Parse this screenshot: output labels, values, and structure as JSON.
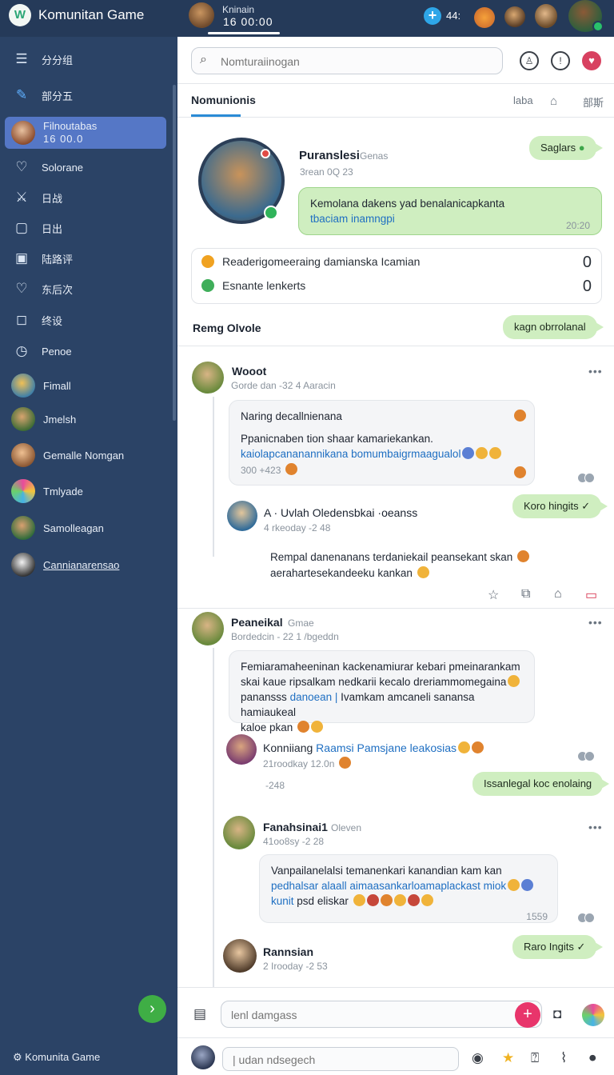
{
  "app": {
    "title": "Komunitan Game"
  },
  "topbar": {
    "user_name": "Kninain",
    "user_time": "16 00:00",
    "count": "44:"
  },
  "sidebar": {
    "items": [
      {
        "label": "分分组",
        "icon": "menu-icon"
      },
      {
        "label": "部分五",
        "icon": "edit-icon"
      },
      {
        "label": "Filnoutabas",
        "sub": "16 00.0",
        "icon": "avatar"
      },
      {
        "label": "Solorane",
        "icon": "heart-icon"
      },
      {
        "label": "日战",
        "icon": "sword-icon"
      },
      {
        "label": "日出",
        "icon": "file-icon"
      },
      {
        "label": "陆路评",
        "icon": "board-icon"
      },
      {
        "label": "东后次",
        "icon": "heart-icon"
      },
      {
        "label": "终设",
        "icon": "chat-icon"
      },
      {
        "label": "Penoe",
        "icon": "clock-icon"
      },
      {
        "label": "Fimall",
        "icon": "avatar"
      },
      {
        "label": "Jmelsh",
        "icon": "avatar"
      },
      {
        "label": "Gemalle Nomgan",
        "icon": "avatar"
      },
      {
        "label": "Tmlyade",
        "icon": "avatar"
      },
      {
        "label": "Samolleagan",
        "icon": "avatar"
      },
      {
        "label": "Cannianarensao",
        "icon": "avatar"
      }
    ],
    "footer": "Komunita Game"
  },
  "header": {
    "search_placeholder": "Nomturaiinogan",
    "tab_title": "Nomunionis",
    "tab_link_1": "laba",
    "tab_link_2": "部斯"
  },
  "profile": {
    "name": "Puranslesi",
    "badge": "Genas",
    "time": "3rean 0Q 23",
    "saglars": "Saglars",
    "message_line1": "Kemolana dakens yad benalanicapkanta",
    "message_line2": "tbaciam inamngpi",
    "message_time": "20:20"
  },
  "stats": [
    {
      "label": "Readerigomeeraing damianska Icamian",
      "value": "0",
      "color": "#f0a221"
    },
    {
      "label": "Esnante lenkerts",
      "value": "0",
      "color": "#3fae5a"
    }
  ],
  "section": {
    "title": "Remg Olvole",
    "pill": "kagn obrrolanal"
  },
  "posts": [
    {
      "name": "Wooot",
      "meta": "Gorde dan -32 4 Aaracin",
      "line0": "Naring decallnienana",
      "line1": "Ppanicnaben tion shaar kamariekankan.",
      "line2": "kaiolapcananannikana bomumbaigrmaagualol",
      "foot": "300 +423",
      "reply": {
        "name": "A · Uvlah Oledensbkai ·oeanss",
        "meta": "4 rkeoday -2 48",
        "text1": "Rempal danenanans terdaniekail peansekant skan",
        "text2": "aerahartesekandeeku kankan",
        "pill": "Koro hingits ✓"
      }
    },
    {
      "name": "Peaneikal",
      "badge": "Gmae",
      "meta": "Bordedcin - 22 1 /bgeddn",
      "line1": "Femiaramaheeninan kackenamiurar kebari pmeinarankam",
      "line2": "skai kaue ripsalkam nedkarii kecalo dreriammomegaina",
      "line3a": "panansss",
      "line3b": "danoean |",
      "line3c": "Ivamkam amcaneli sanansa hamiaukeal",
      "line4": "kaloe pkan",
      "reply": {
        "name": "Konniiang",
        "name_blue": "Raamsi Pamsjane leakosias",
        "meta": "21roodkay 12.0n",
        "extra": "-248",
        "pill": "Issanlegal koc enolaing"
      }
    },
    {
      "name": "Fanahsinai1",
      "badge": "Oleven",
      "meta": "41oo8sy -2 28",
      "line1": "Vanpailanelalsi temanenkari kanandian kam kan",
      "line2": "pedhalsar alaall aimaasankarloamaplackast miok",
      "line3a": "kunit",
      "line3b": "psd eliskar",
      "time": "1559"
    },
    {
      "name": "Rannsian",
      "meta": "2 Irooday -2 53",
      "pill": "Raro Ingits ✓"
    }
  ],
  "composer": {
    "placeholder": "lenl damgass",
    "placeholder2": "| udan ndsegech"
  }
}
